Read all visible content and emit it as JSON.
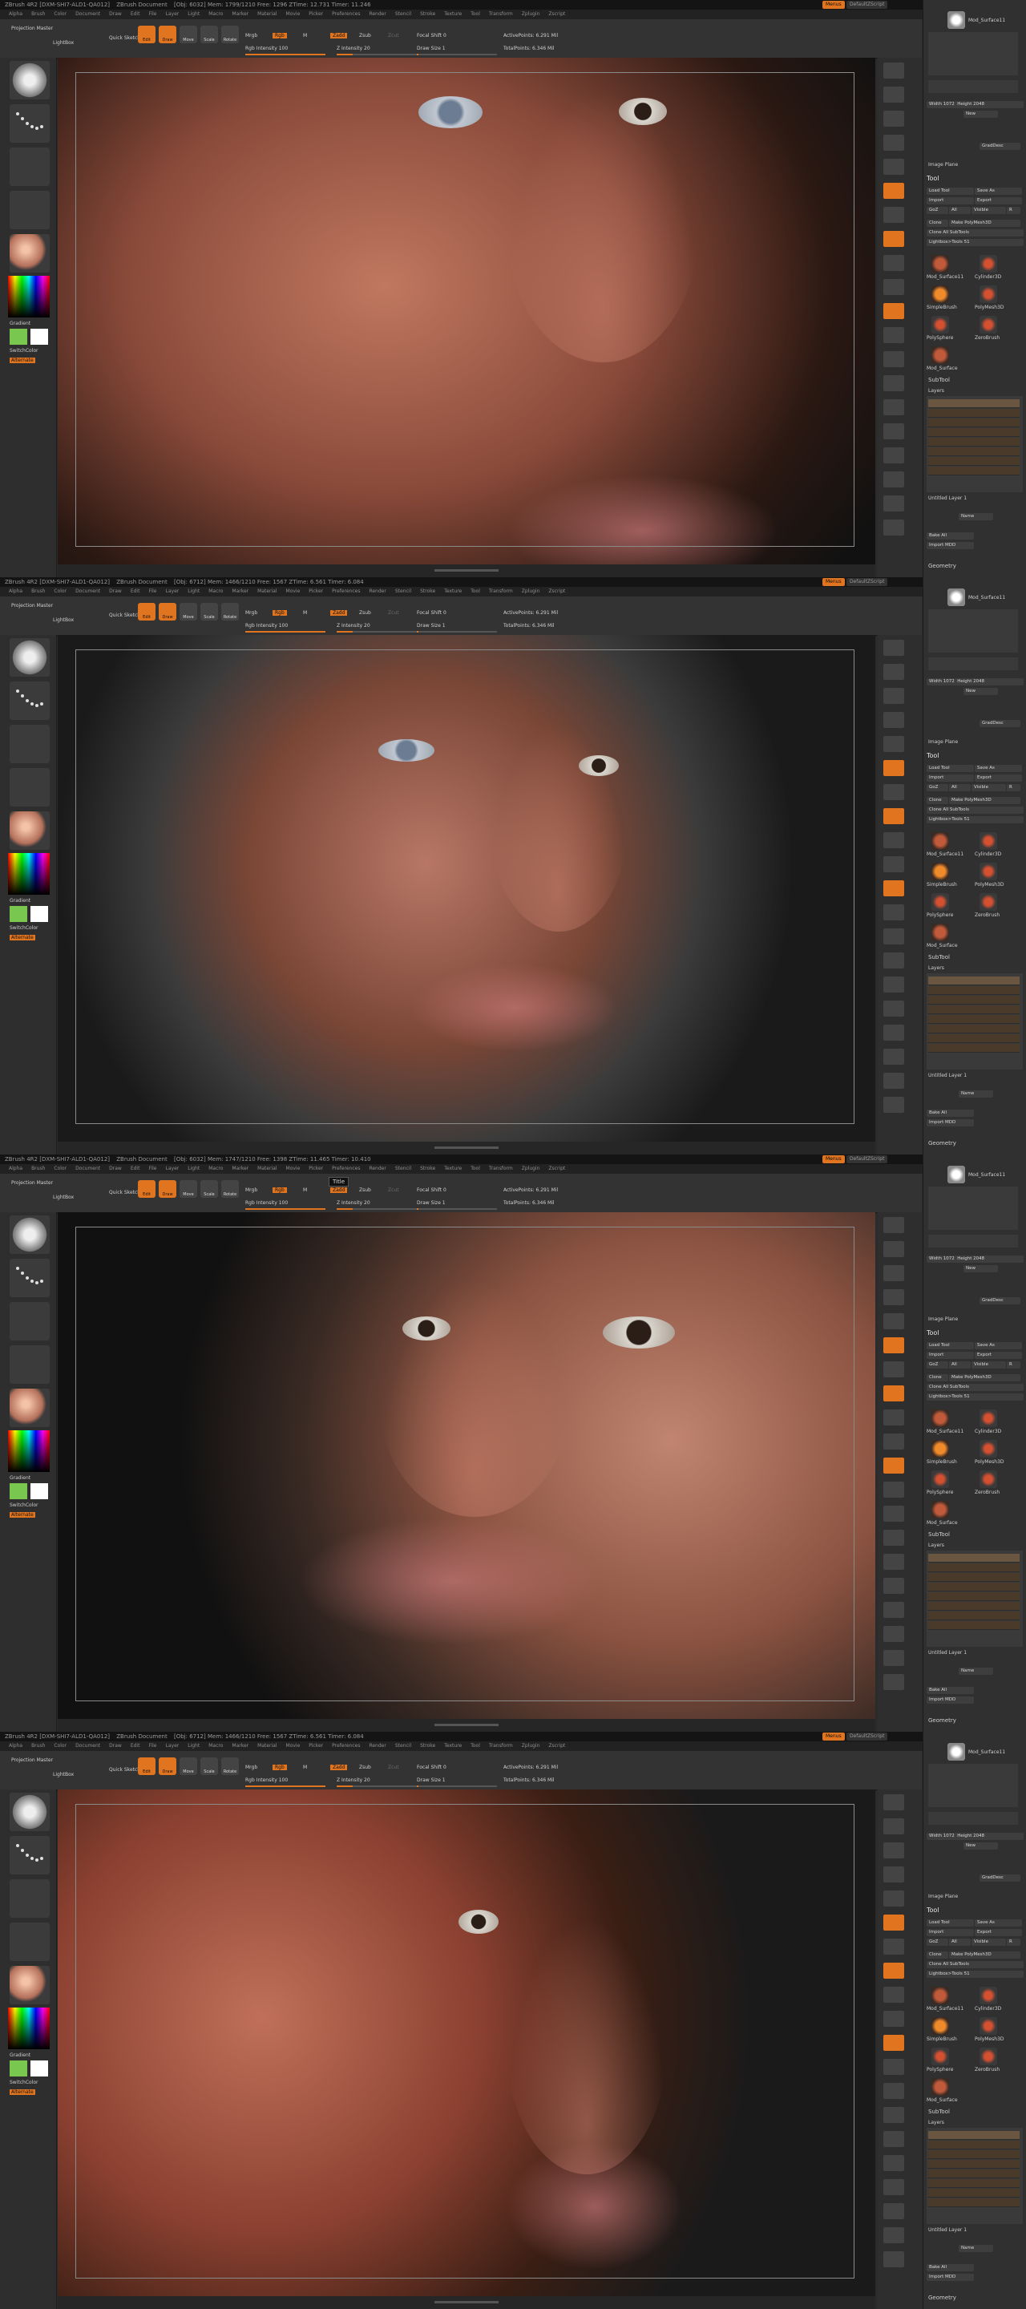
{
  "app_title": "ZBrush 4R2 [DXM-SHI7-ALD1-QA012]",
  "doc_title": "ZBrush Document",
  "header_btn": "Menus",
  "script_name": "DefaultZScript",
  "menu_items": [
    "Alpha",
    "Brush",
    "Color",
    "Document",
    "Draw",
    "Edit",
    "File",
    "Layer",
    "Light",
    "Macro",
    "Marker",
    "Material",
    "Movie",
    "Picker",
    "Preferences",
    "Render",
    "Stencil",
    "Stroke",
    "Texture",
    "Tool",
    "Transform",
    "Zplugin",
    "Zscript"
  ],
  "tooltip": "Title",
  "toolbar": {
    "projection_master": "Projection Master",
    "lightbox": "LightBox",
    "quick_sketch": "Quick Sketch",
    "edit": "Edit",
    "draw": "Draw",
    "move": "Move",
    "scale": "Scale",
    "rotate": "Rotate",
    "mrgb": "Mrgb",
    "rgb": "Rgb",
    "m": "M",
    "zadd": "Zadd",
    "zsub": "Zsub",
    "zcut": "Zcut",
    "rgb_intensity": "Rgb Intensity 100",
    "z_intensity": "Z Intensity 20",
    "focal_shift": "Focal Shift 0",
    "draw_size": "Draw Size 1",
    "active_points": "ActivePoints: 6.291 Mil",
    "total_points": "TotalPoints: 6.346 Mil"
  },
  "panels": [
    {
      "stats": "[Obj: 6032]  Mem: 1799/1210  Free: 1296  ZTime: 12.731  Timer: 11.246"
    },
    {
      "stats": "[Obj: 6712]  Mem: 1466/1210  Free: 1567  ZTime: 6.561  Timer: 6.084"
    },
    {
      "stats": "[Obj: 6032]  Mem: 1747/1210  Free: 1398  ZTime: 11.465  Timer: 10.410"
    },
    {
      "stats": "[Obj: 6712]  Mem: 1466/1210  Free: 1567  ZTime: 6.561  Timer: 6.084"
    }
  ],
  "left_tray": {
    "gradient": "Gradient",
    "switch_color": "SwitchColor",
    "alternate": "Alternate"
  },
  "right_tray": {
    "tool_name": "Mod_Surface11",
    "width": "Width 1072",
    "height": "Height 2048",
    "new": "New",
    "gradient_btn": "GradDesc",
    "image_plane": "Image Plane",
    "tool": "Tool",
    "load_tool": "Load Tool",
    "save_as": "Save As",
    "import": "Import",
    "export": "Export",
    "goz": "GoZ",
    "all": "All",
    "visible": "Visible",
    "r": "R",
    "clone": "Clone",
    "make_polymesh": "Make PolyMesh3D",
    "clone_all_subtools": "Clone All SubTools",
    "lightbox_tools": "Lightbox>Tools",
    "tool_count": "51",
    "tools": [
      "Mod_Surface11",
      "Cylinder3D",
      "SimpleBrush",
      "PolyMesh3D",
      "PolySphere",
      "ZeroBrush",
      "Mod_Surface"
    ],
    "subtool": "SubTool",
    "layers": "Layers",
    "untitled_layer": "Untitled Layer 1",
    "name": "Name",
    "bake_all": "Bake All",
    "import_mdd": "Import MDD",
    "geometry": "Geometry"
  }
}
